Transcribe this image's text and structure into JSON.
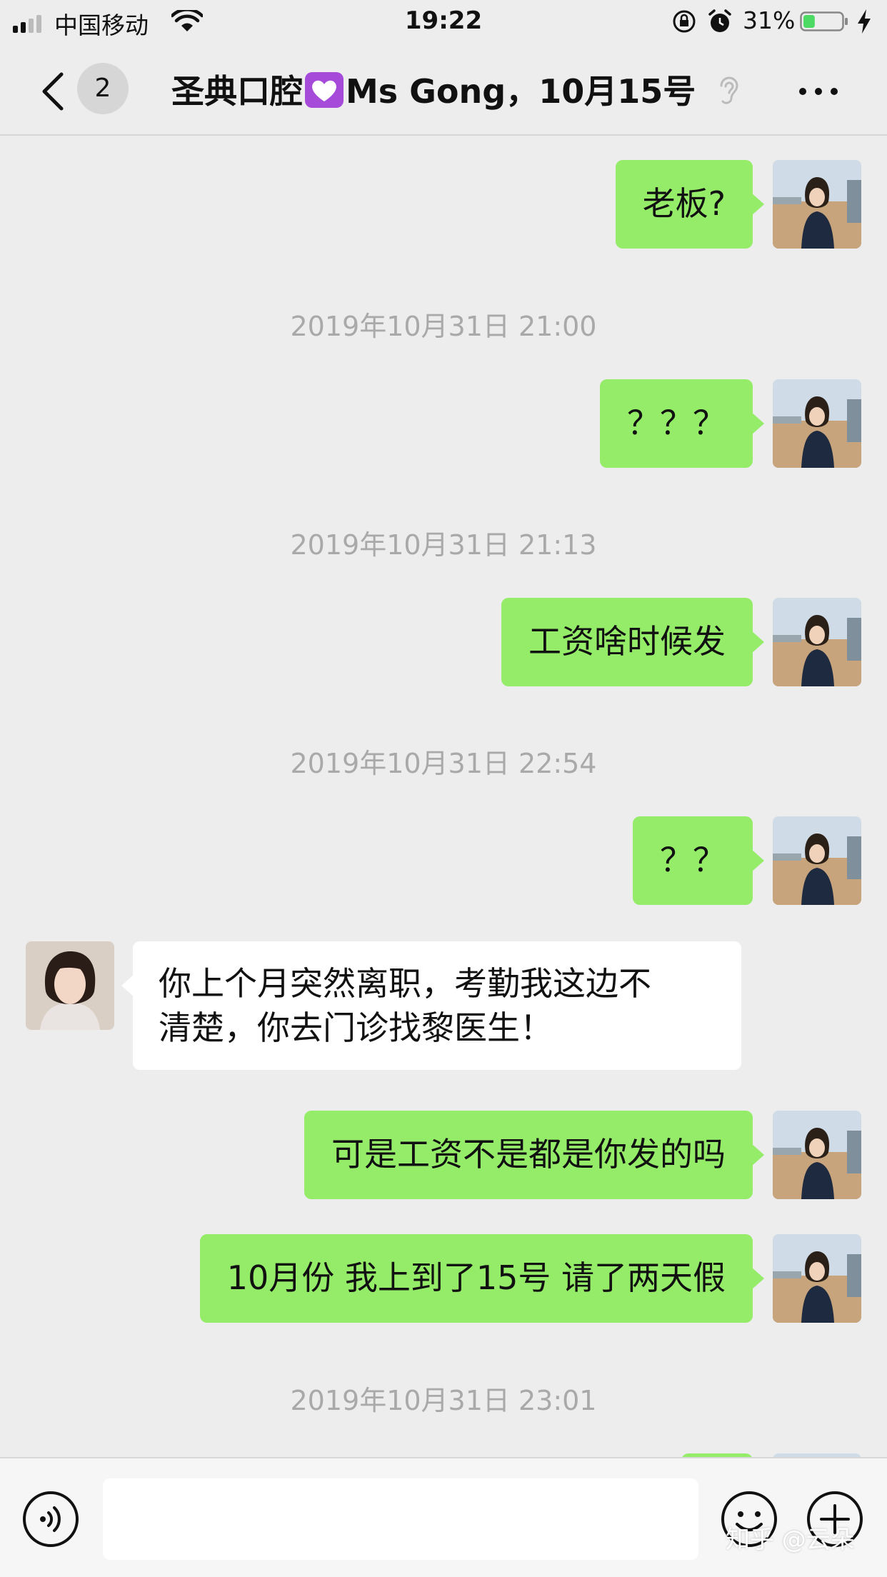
{
  "status_bar": {
    "carrier": "中国移动",
    "time": "19:22",
    "battery_percent": "31%",
    "battery_level": 0.31,
    "battery_color": "#4cd964"
  },
  "nav": {
    "back_icon": "chevron-left-icon",
    "unread_count": "2",
    "title_prefix": "圣典口腔",
    "title_heart_icon": "purple-heart-icon",
    "title_suffix": "Ms Gong，10月15号",
    "mute_icon": "ear-icon",
    "more_icon": "more-icon"
  },
  "messages": [
    {
      "type": "sent",
      "text": "老板?"
    },
    {
      "type": "time",
      "text": "2019年10月31日 21:00"
    },
    {
      "type": "sent",
      "text": "？？？"
    },
    {
      "type": "time",
      "text": "2019年10月31日 21:13"
    },
    {
      "type": "sent",
      "text": "工资啥时候发"
    },
    {
      "type": "time",
      "text": "2019年10月31日 22:54"
    },
    {
      "type": "sent",
      "text": "？？"
    },
    {
      "type": "received",
      "lines": [
        "你上个月突然离职，考勤我这边不",
        "清楚，你去门诊找黎医生！"
      ]
    },
    {
      "type": "sent",
      "text": "可是工资不是都是你发的吗"
    },
    {
      "type": "sent",
      "text": "10月份 我上到了15号 请了两天假"
    },
    {
      "type": "time",
      "text": "2019年10月31日 23:01"
    }
  ],
  "input_bar": {
    "voice_icon": "voice-icon",
    "emoji_icon": "emoji-icon",
    "plus_icon": "plus-icon"
  },
  "watermark": "知乎 @云朵",
  "colors": {
    "background": "#ededed",
    "sent_bubble": "#95ec69",
    "received_bubble": "#ffffff",
    "timestamp_text": "#a9a9a9",
    "heart": "#a64bd9"
  }
}
